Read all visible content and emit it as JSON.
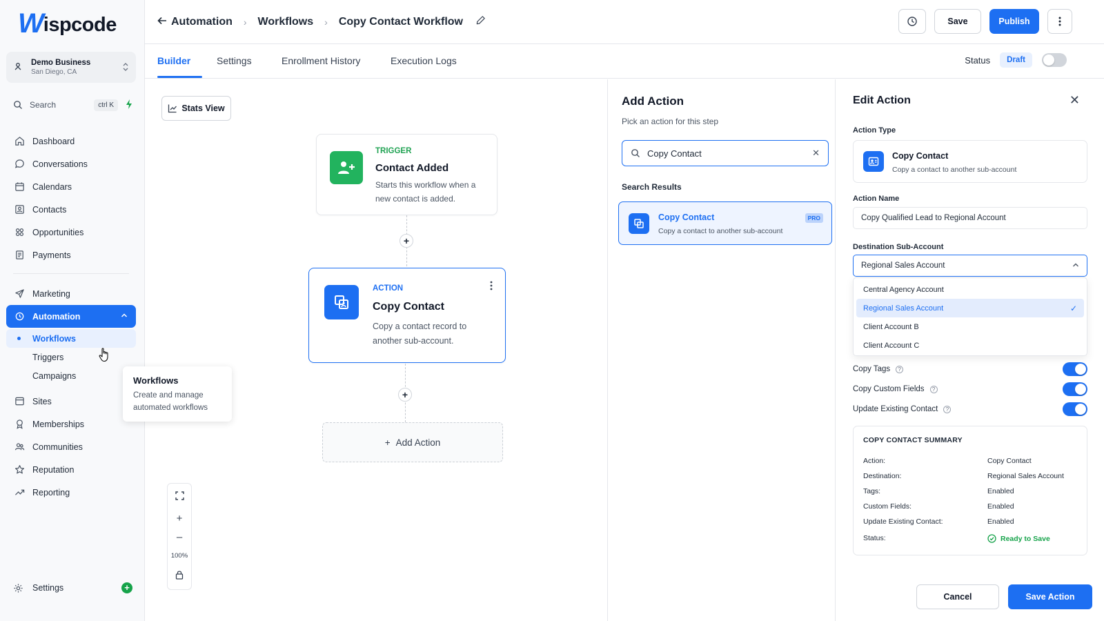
{
  "brand": {
    "logo_mark": "W",
    "logo_text": "ispcode"
  },
  "business": {
    "name": "Demo Business",
    "location": "San Diego, CA"
  },
  "search": {
    "label": "Search",
    "shortcut": "ctrl K"
  },
  "sidebar": {
    "items": [
      {
        "label": "Dashboard",
        "icon": "home-icon"
      },
      {
        "label": "Conversations",
        "icon": "chat-icon"
      },
      {
        "label": "Calendars",
        "icon": "calendar-icon"
      },
      {
        "label": "Contacts",
        "icon": "contacts-icon"
      },
      {
        "label": "Opportunities",
        "icon": "opportunities-icon"
      },
      {
        "label": "Payments",
        "icon": "payments-icon"
      }
    ],
    "items2": [
      {
        "label": "Marketing",
        "icon": "send-icon"
      },
      {
        "label": "Automation",
        "icon": "automation-icon"
      }
    ],
    "sub_items": [
      {
        "label": "Workflows"
      },
      {
        "label": "Triggers"
      },
      {
        "label": "Campaigns"
      }
    ],
    "items3": [
      {
        "label": "Sites",
        "icon": "sites-icon"
      },
      {
        "label": "Memberships",
        "icon": "memberships-icon"
      },
      {
        "label": "Communities",
        "icon": "communities-icon"
      },
      {
        "label": "Reputation",
        "icon": "star-icon"
      },
      {
        "label": "Reporting",
        "icon": "reporting-icon"
      }
    ],
    "settings": "Settings"
  },
  "tooltip": {
    "title": "Workflows",
    "desc": "Create and manage automated workflows"
  },
  "breadcrumb": {
    "root": "Automation",
    "mid": "Workflows",
    "current": "Copy Contact Workflow"
  },
  "toolbar": {
    "save": "Save",
    "publish": "Publish"
  },
  "tabs": [
    "Builder",
    "Settings",
    "Enrollment History",
    "Execution Logs"
  ],
  "status": {
    "label": "Status",
    "value": "Draft"
  },
  "canvas": {
    "stats_view": "Stats View",
    "trigger": {
      "kind": "TRIGGER",
      "title": "Contact Added",
      "desc": "Starts this workflow when a new contact is added."
    },
    "action": {
      "kind": "ACTION",
      "title": "Copy Contact",
      "desc": "Copy a contact record to another sub-account."
    },
    "add_action": "Add Action",
    "zoom": "100%"
  },
  "add_panel": {
    "title": "Add Action",
    "subtitle": "Pick an action for this step",
    "search_value": "Copy Contact",
    "results_label": "Search Results",
    "result": {
      "title": "Copy Contact",
      "desc": "Copy a contact to another sub-account",
      "badge": "PRO"
    }
  },
  "edit_panel": {
    "title": "Edit Action",
    "action_type_label": "Action Type",
    "action_type": {
      "title": "Copy Contact",
      "desc": "Copy a contact to another sub-account"
    },
    "action_name_label": "Action Name",
    "action_name": "Copy Qualified Lead to Regional Account",
    "destination_label": "Destination Sub-Account",
    "destination": "Regional Sales Account",
    "options": [
      "Central Agency Account",
      "Regional Sales Account",
      "Client Account B",
      "Client Account C"
    ],
    "selected_index": 1,
    "toggles": [
      {
        "label": "Copy Tags",
        "on": true
      },
      {
        "label": "Copy Custom Fields",
        "on": true
      },
      {
        "label": "Update Existing Contact",
        "on": true
      }
    ],
    "summary": {
      "heading": "COPY CONTACT SUMMARY",
      "rows": [
        {
          "k": "Action:",
          "v": "Copy Contact"
        },
        {
          "k": "Destination:",
          "v": "Regional Sales Account"
        },
        {
          "k": "Tags:",
          "v": "Enabled"
        },
        {
          "k": "Custom Fields:",
          "v": "Enabled"
        },
        {
          "k": "Update Existing Contact:",
          "v": "Enabled"
        },
        {
          "k": "Status:",
          "v": "Ready to Save"
        }
      ]
    },
    "cancel": "Cancel",
    "save": "Save Action"
  },
  "colors": {
    "accent": "#1d6ff2",
    "success": "#16a34a",
    "trigger_green": "#22b35e"
  }
}
